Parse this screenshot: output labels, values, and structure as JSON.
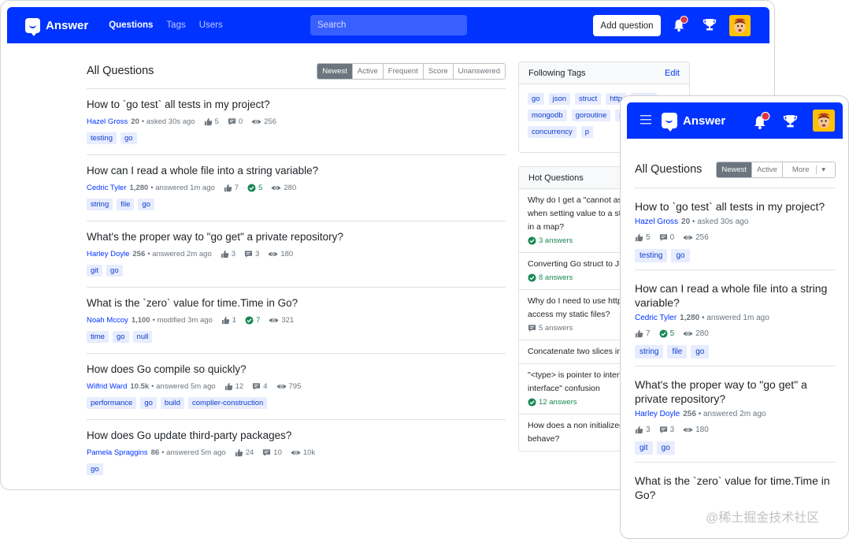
{
  "brand": {
    "name": "Answer"
  },
  "nav": {
    "links": [
      "Questions",
      "Tags",
      "Users"
    ],
    "search_placeholder": "Search",
    "add_question": "Add question"
  },
  "main": {
    "title": "All Questions",
    "sort_tabs": [
      "Newest",
      "Active",
      "Frequent",
      "Score",
      "Unanswered"
    ],
    "questions": [
      {
        "title": "How to `go test` all tests in my project?",
        "author": "Hazel Gross",
        "rep": "20",
        "action": "• asked 30s ago",
        "votes": "5",
        "answers": "0",
        "views": "256",
        "tags": [
          "testing",
          "go"
        ],
        "accepted": false
      },
      {
        "title": "How can I read a whole file into a string variable?",
        "author": "Cedric Tyler",
        "rep": "1,280",
        "action": "• answered 1m ago",
        "votes": "7",
        "answers": "5",
        "views": "280",
        "tags": [
          "string",
          "file",
          "go"
        ],
        "accepted": true
      },
      {
        "title": "What's the proper way to \"go get\" a private repository?",
        "author": "Harley Doyle",
        "rep": "256",
        "action": "• answered 2m ago",
        "votes": "3",
        "answers": "3",
        "views": "180",
        "tags": [
          "git",
          "go"
        ],
        "accepted": false
      },
      {
        "title": "What is the `zero` value for time.Time in Go?",
        "author": "Noah Mccoy",
        "rep": "1,100",
        "action": "• modified 3m ago",
        "votes": "1",
        "answers": "7",
        "views": "321",
        "tags": [
          "time",
          "go",
          "null"
        ],
        "accepted": true
      },
      {
        "title": "How does Go compile so quickly?",
        "author": "Wilfrid Ward",
        "rep": "10.5k",
        "action": "• answered 5m ago",
        "votes": "12",
        "answers": "4",
        "views": "795",
        "tags": [
          "performance",
          "go",
          "build",
          "complier-construction"
        ],
        "accepted": false
      },
      {
        "title": "How does Go update third-party packages?",
        "author": "Pamela Spraggins",
        "rep": "86",
        "action": "• answered 5m ago",
        "votes": "24",
        "answers": "10",
        "views": "10k",
        "tags": [
          "go"
        ],
        "accepted": false
      }
    ]
  },
  "sidebar": {
    "following_title": "Following Tags",
    "edit_label": "Edit",
    "following_tags": [
      "go",
      "json",
      "struct",
      "http",
      "struct",
      "mongodb",
      "goroutine",
      "p",
      "slice",
      "concurrency",
      "p"
    ],
    "hot_title": "Hot Questions",
    "hot_questions": [
      {
        "title": "Why do I get a \"cannot assign\" error when setting value to a struct as a value in a map?",
        "answers": "3 answers",
        "accepted": true
      },
      {
        "title": "Converting Go struct to JSON",
        "answers": "8 answers",
        "accepted": true
      },
      {
        "title": "Why do I need to use http.StripPrefix to access my static files?",
        "answers": "5 answers",
        "accepted": false
      },
      {
        "title": "Concatenate two slices in Go",
        "answers": "",
        "accepted": false
      },
      {
        "title": "\"<type> is pointer to interface, not interface\" confusion",
        "answers": "12 answers",
        "accepted": true
      },
      {
        "title": "How does a non initialized channel behave?",
        "answers": "",
        "accepted": false
      }
    ]
  },
  "mobile": {
    "title": "All Questions",
    "sort_tabs": [
      "Newest",
      "Active",
      "More"
    ],
    "questions": [
      {
        "title": "How to `go test` all tests in my project?",
        "author": "Hazel Gross",
        "rep": "20",
        "action": "• asked 30s ago",
        "votes": "5",
        "answers": "0",
        "views": "256",
        "tags": [
          "testing",
          "go"
        ],
        "accepted": false
      },
      {
        "title": "How can I read a whole file into a string variable?",
        "author": "Cedric Tyler",
        "rep": "1,280",
        "action": "• answered 1m ago",
        "votes": "7",
        "answers": "5",
        "views": "280",
        "tags": [
          "string",
          "file",
          "go"
        ],
        "accepted": true
      },
      {
        "title": "What's the proper way to \"go get\" a private repository?",
        "author": "Harley Doyle",
        "rep": "256",
        "action": "• answered 2m ago",
        "votes": "3",
        "answers": "3",
        "views": "180",
        "tags": [
          "git",
          "go"
        ],
        "accepted": false
      },
      {
        "title": "What is the `zero` value for time.Time in Go?",
        "author": "",
        "rep": "",
        "action": "",
        "votes": "",
        "answers": "",
        "views": "",
        "tags": [],
        "accepted": false
      }
    ]
  },
  "watermark": "@稀土掘金技术社区",
  "colors": {
    "brand": "#0033ff",
    "tag_bg": "#e7ecfe",
    "tag_text": "#0d3dcc",
    "accepted": "#198754",
    "notify": "#dc3545",
    "avatar": "#ffc107"
  }
}
